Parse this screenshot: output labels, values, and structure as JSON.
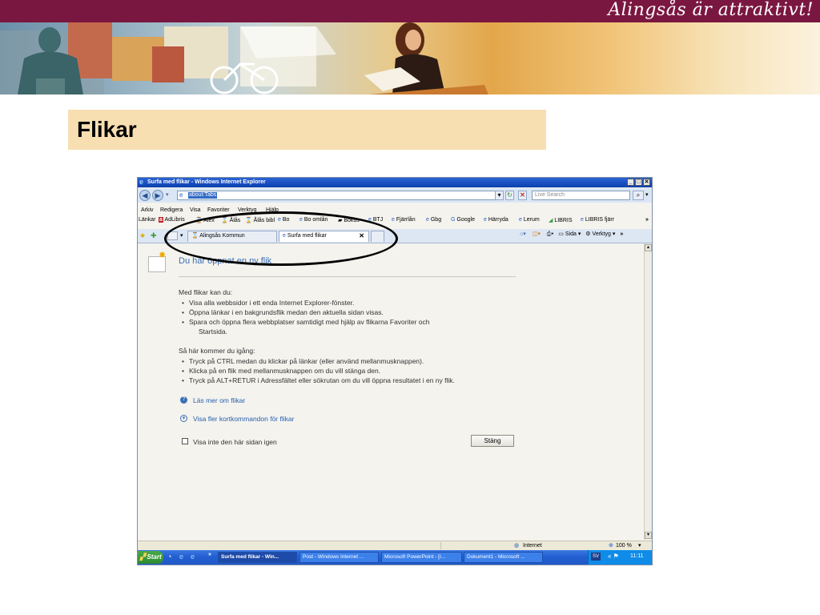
{
  "slide": {
    "tagline": "Alingsås är attraktivt!",
    "title": "Flikar"
  },
  "browser": {
    "window_title": "Surfa med flikar - Windows Internet Explorer",
    "address": "about:Tabs",
    "search_placeholder": "Live Search",
    "menu": [
      "Arkiv",
      "Redigera",
      "Visa",
      "Favoriter",
      "Verktyg",
      "Hjälp"
    ],
    "links": [
      "Länkar",
      "AdLibris",
      "Alex",
      "Ålås",
      "Ålås bibl",
      "Bo",
      "Bo omlån",
      "Bokus",
      "BTJ",
      "Fjärrlån",
      "Gbg",
      "Google",
      "Härryda",
      "Lerum",
      "LIBRIS",
      "LIBRIS fjärr"
    ],
    "tabs": [
      {
        "label": "Alingsås Kommun",
        "active": false
      },
      {
        "label": "Surfa med flikar",
        "active": true
      }
    ],
    "commands": {
      "page": "Sida",
      "tools": "Verktyg"
    }
  },
  "page": {
    "heading": "Du har öppnat en ny flik",
    "intro1": "Med flikar kan du:",
    "bullets1": [
      "Visa alla webbsidor i ett enda Internet Explorer-fönster.",
      "Öppna länkar i en bakgrundsflik medan den aktuella sidan visas.",
      "Spara och öppna flera webbplatser samtidigt med hjälp av flikarna Favoriter och",
      "Startsida."
    ],
    "intro2": "Så här kommer du igång:",
    "bullets2": [
      "Tryck på CTRL medan du klickar på länkar (eller använd mellanmusknappen).",
      "Klicka på en flik med mellanmusknappen om du vill stänga den.",
      "Tryck på ALT+RETUR i Adressfältet eller sökrutan om du vill öppna resultatet i en ny flik."
    ],
    "link_more": "Läs mer om flikar",
    "link_shortcuts": "Visa fler kortkommandon för flikar",
    "checkbox_label": "Visa inte den här sidan igen",
    "close_button": "Stäng"
  },
  "status": {
    "zone": "Internet",
    "zoom": "100 %"
  },
  "taskbar": {
    "start": "Start",
    "tasks": [
      {
        "label": "Surfa med flikar - Win...",
        "active": true
      },
      {
        "label": "Post - Windows Internet ...",
        "active": false
      },
      {
        "label": "Microsoft PowerPoint - [I...",
        "active": false
      },
      {
        "label": "Dokument1 - Microsoft ...",
        "active": false
      }
    ],
    "lang": "SV",
    "clock": "11:11"
  }
}
